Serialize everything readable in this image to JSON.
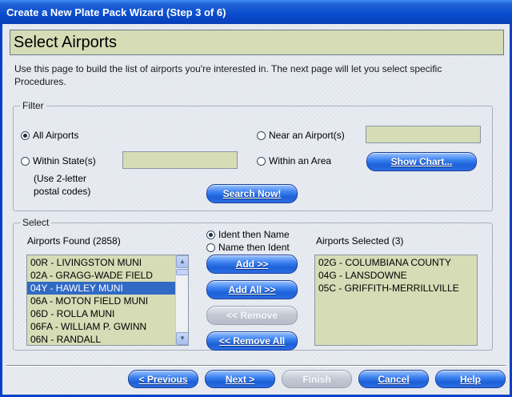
{
  "window": {
    "title": "Create a New Plate Pack Wizard  (Step 3 of 6)"
  },
  "header": {
    "title": "Select Airports"
  },
  "intro": {
    "text": "Use this page to build the list of airports you're interested in.  The next page will let you select specific Procedures."
  },
  "filter": {
    "legend": "Filter",
    "all_airports": {
      "label": "All Airports",
      "checked": true
    },
    "near_airport": {
      "label": "Near an Airport(s)",
      "value": ""
    },
    "within_state": {
      "label": "Within State(s)",
      "value": ""
    },
    "state_note": "(Use 2-letter postal codes)",
    "state_note_1": "(Use 2-letter",
    "state_note_2": "postal codes)",
    "within_area": {
      "label": "Within an Area"
    },
    "show_chart_label": "Show Chart...",
    "search_now_label": "Search Now!"
  },
  "select": {
    "legend": "Select",
    "found_label": "Airports Found (2858)",
    "selected_label": "Airports Selected (3)",
    "sort_ident_then_name": {
      "label": "Ident then Name",
      "checked": true
    },
    "sort_name_then_ident": {
      "label": "Name then Ident",
      "checked": false
    },
    "found_items": [
      "00R - LIVINGSTON MUNI",
      "02A - GRAGG-WADE FIELD",
      "04Y - HAWLEY MUNI",
      "06A - MOTON FIELD MUNI",
      "06D - ROLLA MUNI",
      "06FA - WILLIAM P. GWINN",
      "06N - RANDALL"
    ],
    "found_selected_index": 2,
    "selected_items": [
      "02G - COLUMBIANA COUNTY",
      "04G - LANSDOWNE",
      "05C - GRIFFITH-MERRILLVILLE"
    ],
    "add_label": "Add >>",
    "add_all_label": "Add All >>",
    "remove_label": "<< Remove",
    "remove_all_label": "<< Remove All"
  },
  "footer": {
    "previous_label": "< Previous",
    "next_label": "Next >",
    "finish_label": "Finish",
    "cancel_label": "Cancel",
    "help_label": "Help"
  },
  "colors": {
    "titlebar": "#0a4ccd",
    "field_bg": "#d6dcb6",
    "selection": "#316ac5",
    "button": "#1c5fd8"
  },
  "icons": {
    "scroll_up": "chevron-up-icon",
    "scroll_down": "chevron-down-icon"
  }
}
